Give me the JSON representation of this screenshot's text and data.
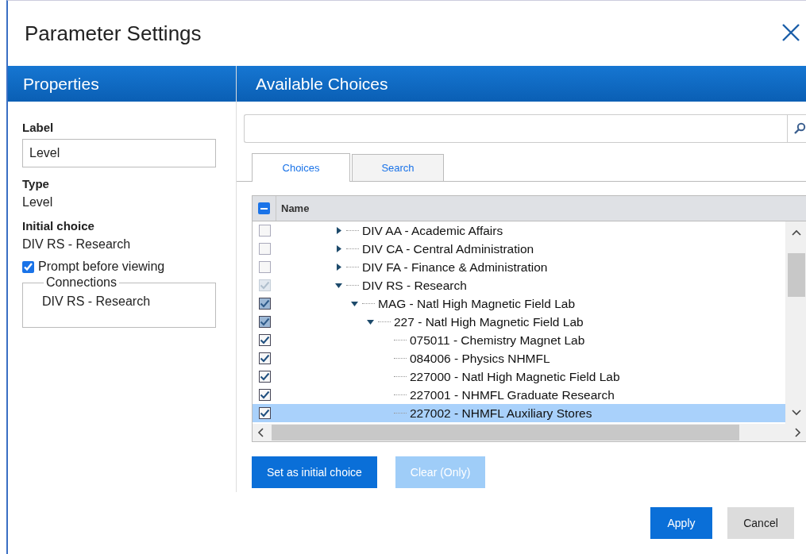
{
  "dialog": {
    "title": "Parameter Settings"
  },
  "properties": {
    "heading": "Properties",
    "label_title": "Label",
    "label_value": "Level",
    "type_title": "Type",
    "type_value": "Level",
    "initial_title": "Initial choice",
    "initial_value": "DIV RS - Research",
    "prompt": {
      "label": "Prompt before viewing",
      "checked": true
    },
    "connections": {
      "legend": "Connections",
      "items": [
        "DIV RS - Research"
      ]
    }
  },
  "choices": {
    "heading": "Available Choices",
    "tabs": [
      {
        "label": "Choices",
        "selected": true
      },
      {
        "label": "Search",
        "selected": false
      }
    ],
    "tree": {
      "header": "Name",
      "header_partial": true,
      "rows": [
        {
          "label": "DIV AA - Academic Affairs",
          "checked": false,
          "partial": false,
          "disabled": false,
          "expanded": false,
          "selected": false
        },
        {
          "label": "DIV CA - Central Administration",
          "checked": false,
          "partial": false,
          "disabled": false,
          "expanded": false,
          "selected": false
        },
        {
          "label": "DIV FA - Finance & Administration",
          "checked": false,
          "partial": false,
          "disabled": false,
          "expanded": false,
          "selected": false
        },
        {
          "label": "DIV RS - Research",
          "checked": true,
          "partial": true,
          "disabled": true,
          "expanded": true,
          "selected": false,
          "children": [
            {
              "label": "MAG - Natl High Magnetic Field Lab",
              "checked": true,
              "partial": true,
              "disabled": false,
              "expanded": true,
              "selected": false,
              "children": [
                {
                  "label": "227 - Natl High Magnetic Field Lab",
                  "checked": true,
                  "partial": true,
                  "disabled": false,
                  "expanded": true,
                  "selected": false,
                  "children": [
                    {
                      "label": "075011 - Chemistry Magnet Lab",
                      "checked": true,
                      "partial": false,
                      "disabled": false,
                      "selected": false
                    },
                    {
                      "label": "084006 - Physics NHMFL",
                      "checked": true,
                      "partial": false,
                      "disabled": false,
                      "selected": false
                    },
                    {
                      "label": "227000 - Natl High Magnetic Field Lab",
                      "checked": true,
                      "partial": false,
                      "disabled": false,
                      "selected": false
                    },
                    {
                      "label": "227001 - NHMFL Graduate Research",
                      "checked": true,
                      "partial": false,
                      "disabled": false,
                      "selected": false
                    },
                    {
                      "label": "227002 - NHMFL Auxiliary Stores",
                      "checked": true,
                      "partial": false,
                      "disabled": false,
                      "selected": true
                    }
                  ]
                }
              ]
            }
          ]
        }
      ]
    },
    "buttons": [
      {
        "label": "Set as initial choice",
        "disabled": false
      },
      {
        "label": "Clear (Only)",
        "disabled": true
      }
    ]
  },
  "footer": [
    {
      "label": "Apply",
      "kind": "primary"
    },
    {
      "label": "Cancel",
      "kind": "secondary"
    }
  ]
}
